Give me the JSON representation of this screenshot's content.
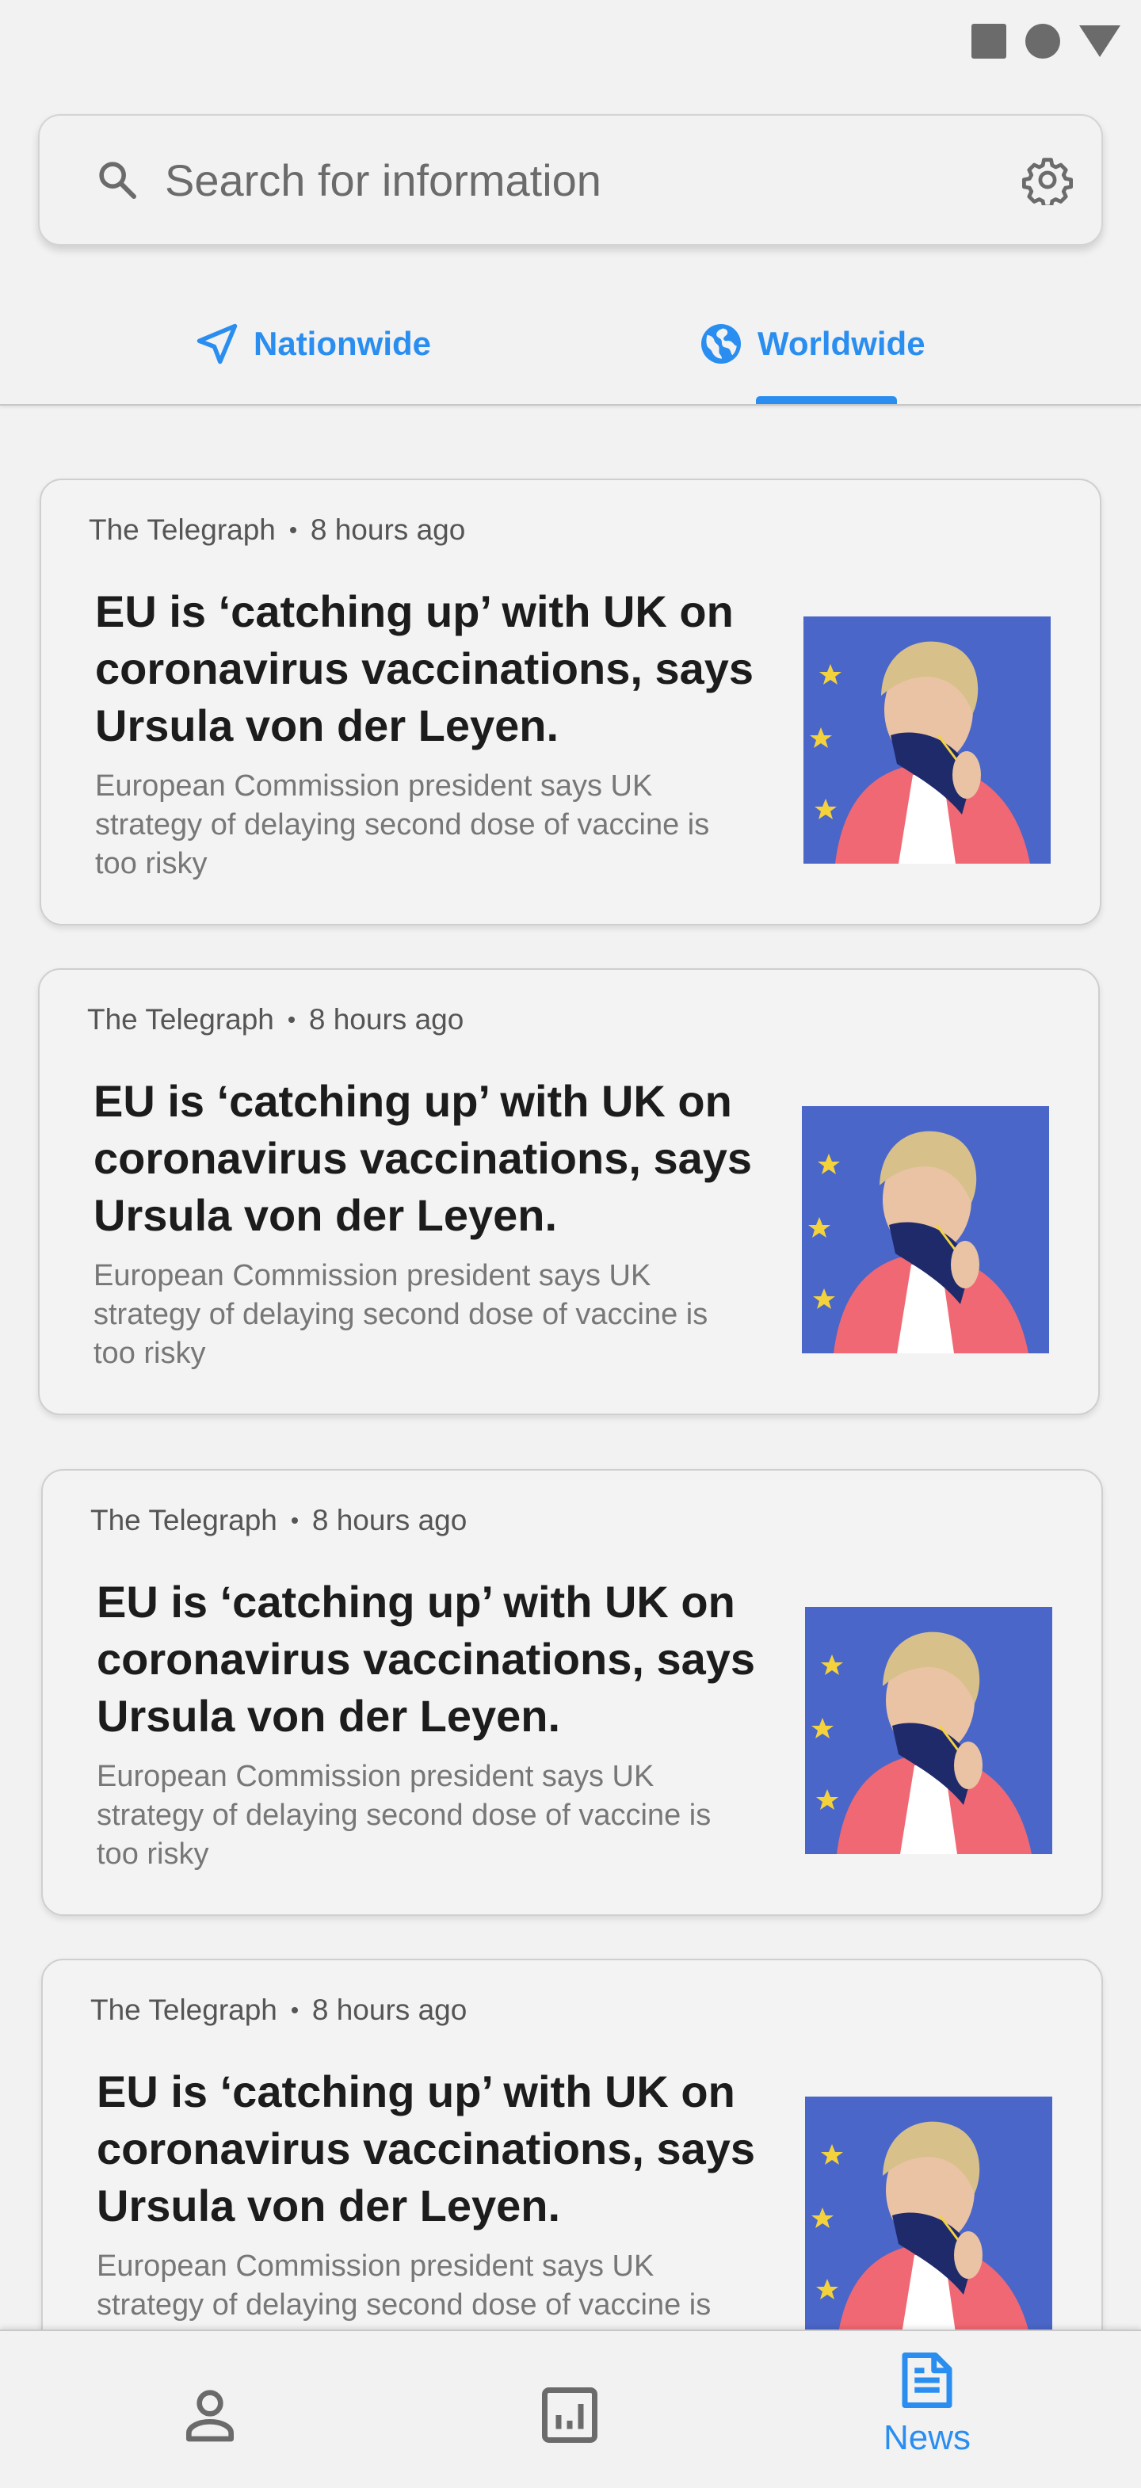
{
  "colors": {
    "accent": "#2a8ef0",
    "background": "#f2f2f2",
    "icon_gray": "#6b6b6b"
  },
  "status_bar": {
    "icons": [
      "square-icon",
      "circle-icon",
      "triangle-icon"
    ]
  },
  "search": {
    "placeholder": "Search for information",
    "icon": "search-icon",
    "settings_icon": "gear-icon"
  },
  "tabs": [
    {
      "label": "Nationwide",
      "icon": "navigation-arrow-icon",
      "selected": false
    },
    {
      "label": "Worldwide",
      "icon": "globe-icon",
      "selected": true
    }
  ],
  "articles": [
    {
      "source": "The Telegraph",
      "time": "8 hours ago",
      "title": "EU is ‘catching up’ with UK on coronavirus vaccinations, says Ursula von der Leyen.",
      "description": "European Commission president says UK strategy of delaying second dose of vaccine is too risky"
    },
    {
      "source": "The Telegraph",
      "time": "8 hours ago",
      "title": "EU is ‘catching up’ with UK on coronavirus vaccinations, says Ursula von der Leyen.",
      "description": "European Commission president says UK strategy of delaying second dose of vaccine is too risky"
    },
    {
      "source": "The Telegraph",
      "time": "8 hours ago",
      "title": "EU is ‘catching up’ with UK on coronavirus vaccinations, says Ursula von der Leyen.",
      "description": "European Commission president says UK strategy of delaying second dose of vaccine is too risky"
    },
    {
      "source": "The Telegraph",
      "time": "8 hours ago",
      "title": "EU is ‘catching up’ with UK on coronavirus vaccinations, says Ursula von der Leyen.",
      "description": "European Commission president says UK strategy of delaying second dose of vaccine is too risky"
    }
  ],
  "bottom_nav": [
    {
      "label": "",
      "icon": "person-icon",
      "active": false
    },
    {
      "label": "",
      "icon": "bar-chart-icon",
      "active": false
    },
    {
      "label": "News",
      "icon": "news-article-icon",
      "active": true
    }
  ]
}
